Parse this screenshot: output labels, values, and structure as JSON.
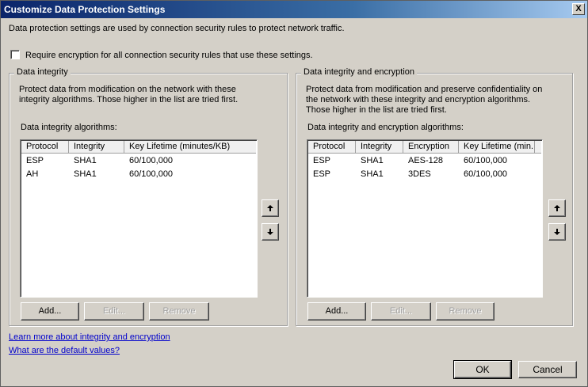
{
  "window": {
    "title": "Customize Data Protection Settings",
    "close_glyph": "X"
  },
  "intro_text": "Data protection settings are used by connection security rules to protect network traffic.",
  "require_encryption": {
    "label": "Require encryption for all connection security rules that use these settings.",
    "checked": false
  },
  "integrity": {
    "legend": "Data integrity",
    "description_line1": "Protect data from modification on the network with these",
    "description_line2": "integrity algorithms. Those higher in the list are tried first.",
    "list_label": "Data integrity algorithms:",
    "columns": [
      "Protocol",
      "Integrity",
      "Key Lifetime (minutes/KB)"
    ],
    "rows": [
      [
        "ESP",
        "SHA1",
        "60/100,000"
      ],
      [
        "AH",
        "SHA1",
        "60/100,000"
      ]
    ],
    "add_label": "Add...",
    "edit_label": "Edit...",
    "remove_label": "Remove"
  },
  "encryption": {
    "legend": "Data integrity and encryption",
    "description_line1": "Protect data from modification and preserve confidentiality on",
    "description_line2": "the network with these integrity and encryption algorithms.",
    "description_line3": "Those higher in the list are tried first.",
    "list_label": "Data integrity and encryption algorithms:",
    "columns": [
      "Protocol",
      "Integrity",
      "Encryption",
      "Key Lifetime (min..."
    ],
    "rows": [
      [
        "ESP",
        "SHA1",
        "AES-128",
        "60/100,000"
      ],
      [
        "ESP",
        "SHA1",
        "3DES",
        "60/100,000"
      ]
    ],
    "add_label": "Add...",
    "edit_label": "Edit...",
    "remove_label": "Remove"
  },
  "links": {
    "learn_more": "Learn more about integrity and encryption",
    "defaults": "What are the default values?"
  },
  "footer": {
    "ok_label": "OK",
    "cancel_label": "Cancel"
  }
}
